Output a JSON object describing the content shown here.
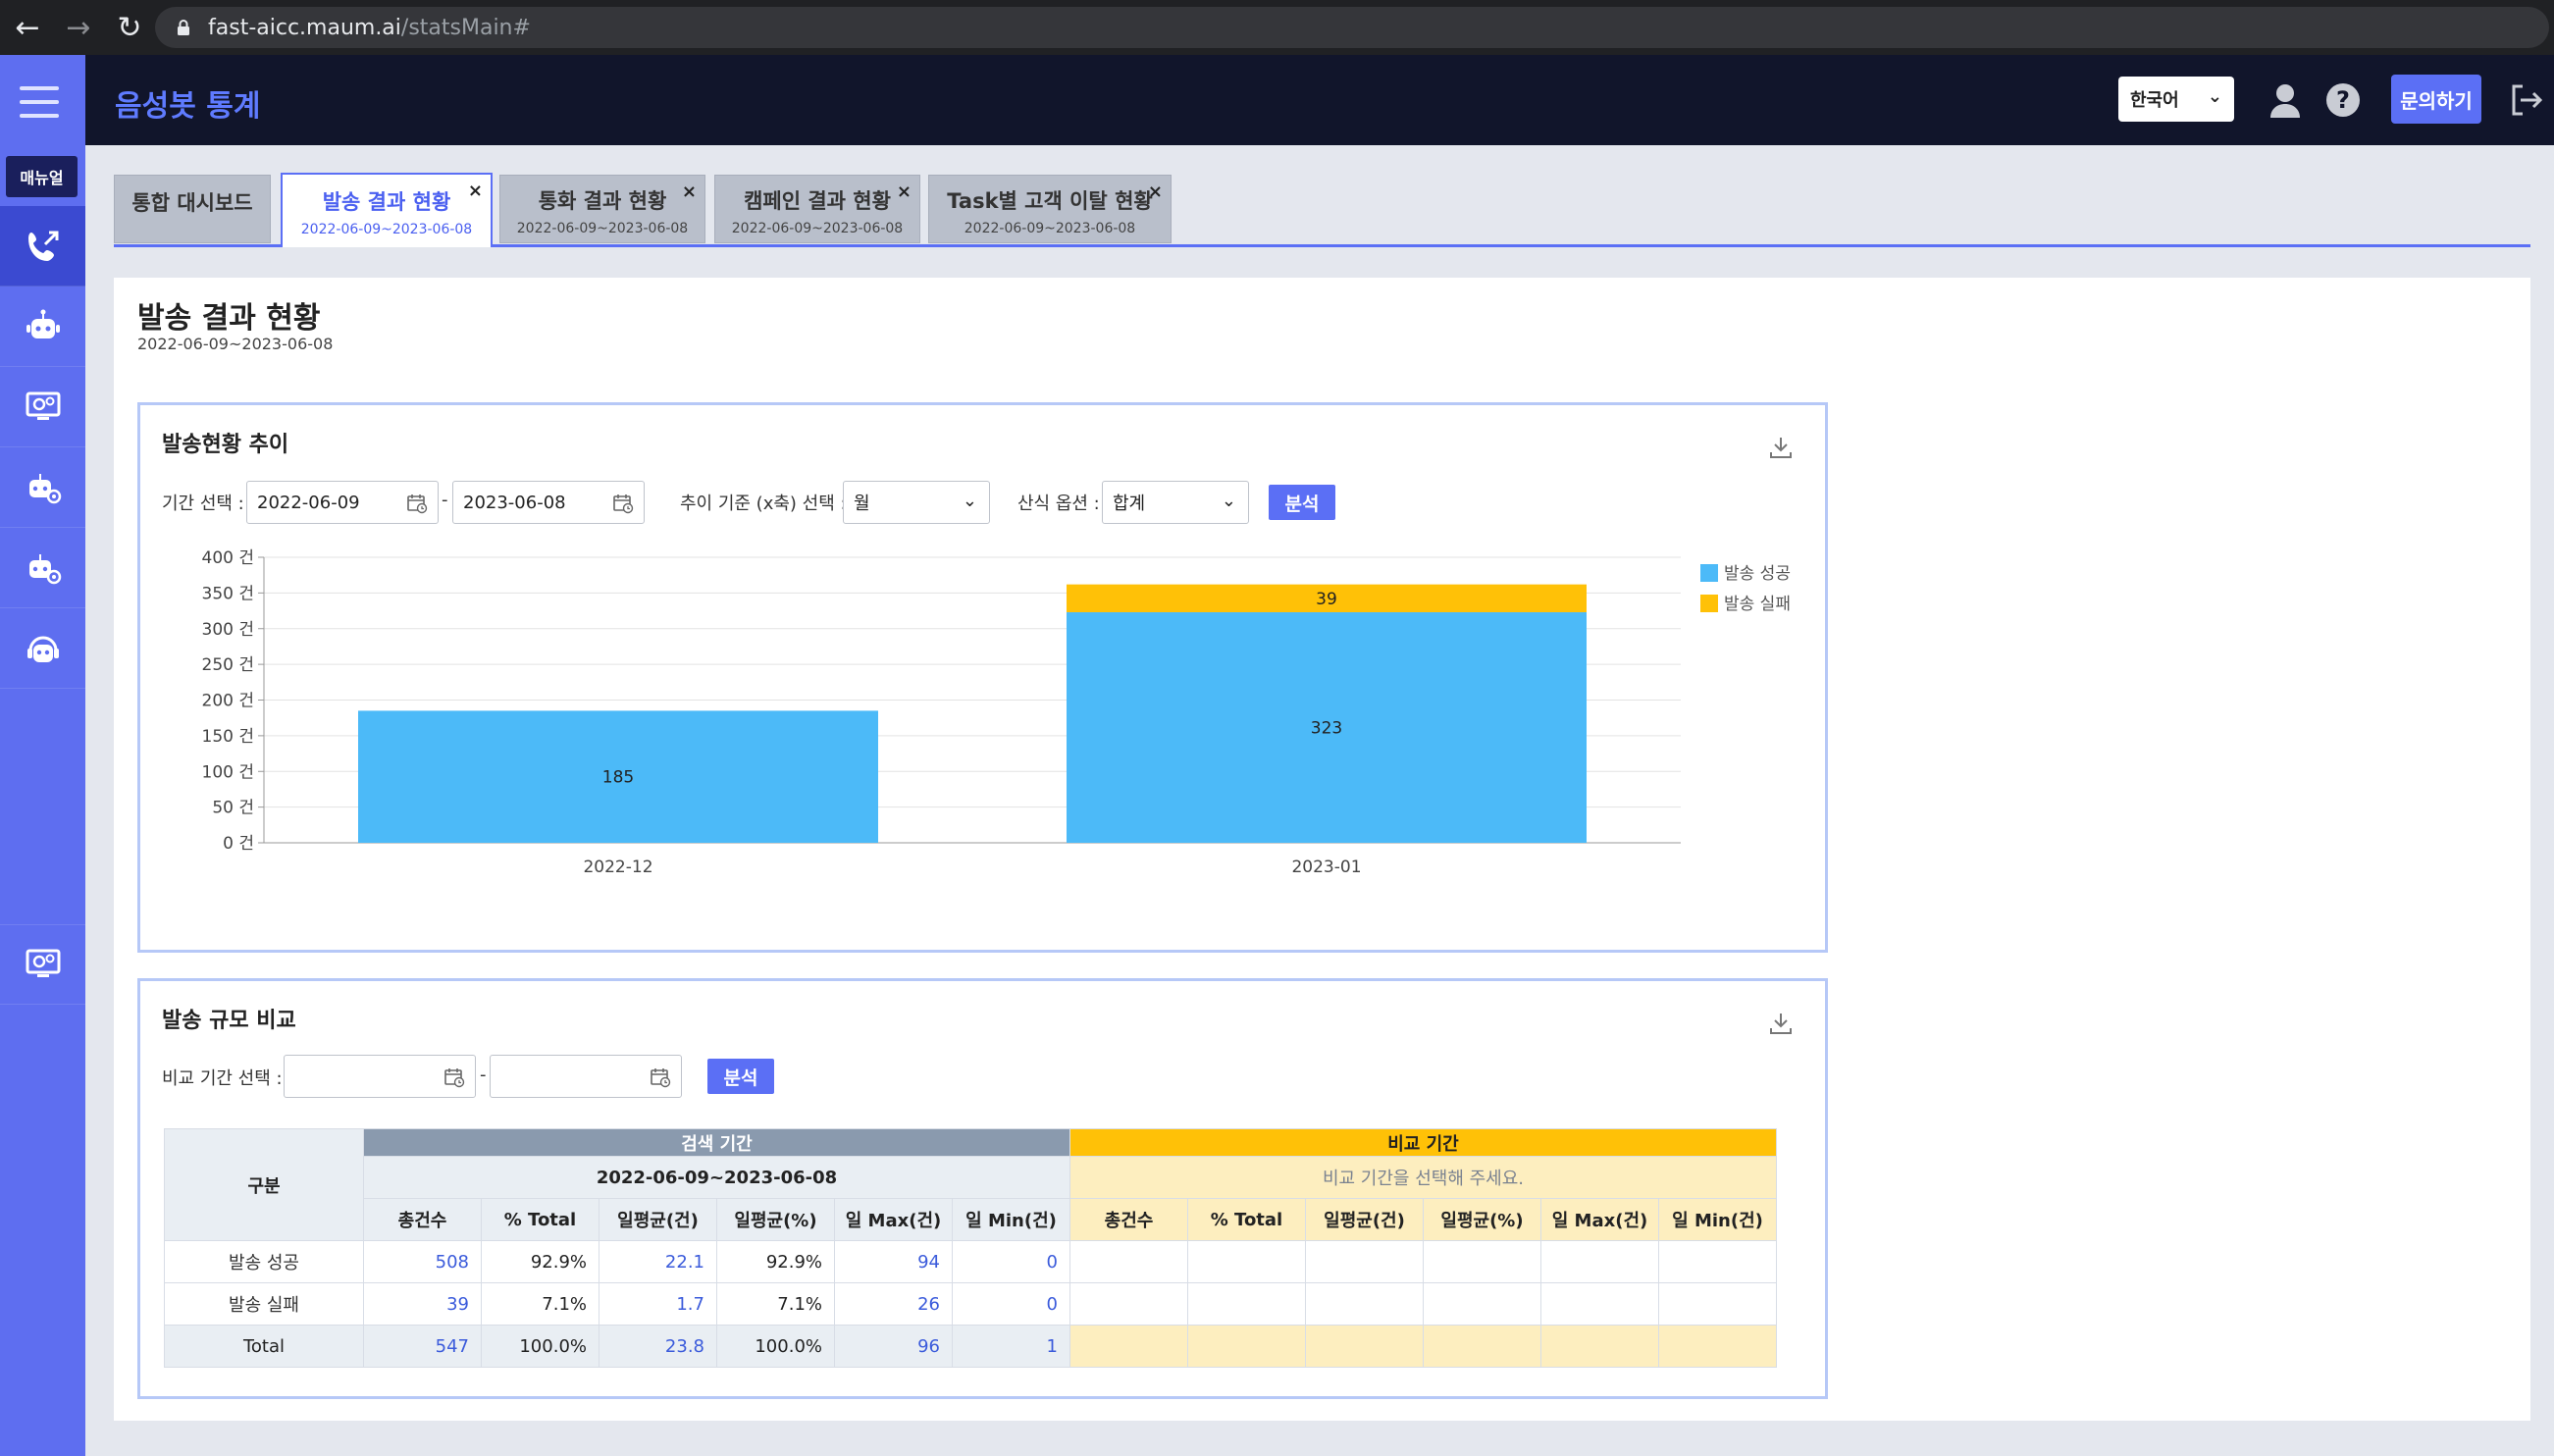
{
  "browser": {
    "url_host": "fast-aicc.maum.ai",
    "url_path": "/statsMain#"
  },
  "sidebar": {
    "manual_label": "매뉴얼",
    "items": [
      {
        "icon": "phone-transfer-icon",
        "active": true
      },
      {
        "icon": "robot-icon",
        "active": false
      },
      {
        "icon": "monitor-settings-icon",
        "active": false
      },
      {
        "icon": "robot-settings-icon",
        "active": false
      },
      {
        "icon": "robot-gear-icon",
        "active": false
      },
      {
        "icon": "headset-robot-icon",
        "active": false
      },
      {
        "icon": "monitor-gear-icon",
        "active": false
      }
    ]
  },
  "header": {
    "title": "음성봇 통계",
    "language": "한국어",
    "ask_label": "문의하기"
  },
  "tabs": [
    {
      "name": "통합 대시보드",
      "date": "",
      "closable": false,
      "active": false
    },
    {
      "name": "발송 결과 현황",
      "date": "2022-06-09~2023-06-08",
      "closable": true,
      "active": true
    },
    {
      "name": "통화 결과 현황",
      "date": "2022-06-09~2023-06-08",
      "closable": true,
      "active": false
    },
    {
      "name": "캠페인 결과 현황",
      "date": "2022-06-09~2023-06-08",
      "closable": true,
      "active": false
    },
    {
      "name": "Task별 고객 이탈 현황",
      "date": "2022-06-09~2023-06-08",
      "closable": true,
      "active": false
    }
  ],
  "page": {
    "title": "발송 결과 현황",
    "date_range": "2022-06-09~2023-06-08"
  },
  "trend_card": {
    "title": "발송현황 추이",
    "period_label": "기간 선택 :",
    "start_date": "2022-06-09",
    "end_date": "2023-06-08",
    "dash": "-",
    "axis_label": "추이 기준 (x축) 선택 :",
    "axis_value": "월",
    "calc_label": "산식 옵션 :",
    "calc_value": "합계",
    "analyze_label": "분석"
  },
  "chart_data": {
    "type": "bar",
    "stacked": true,
    "categories": [
      "2022-12",
      "2023-01"
    ],
    "series": [
      {
        "name": "발송 성공",
        "values": [
          185,
          323
        ],
        "color": "#4cbaf8"
      },
      {
        "name": "발송 실패",
        "values": [
          0,
          39
        ],
        "color": "#ffc107"
      }
    ],
    "ylim": [
      0,
      400
    ],
    "yticks": [
      0,
      50,
      100,
      150,
      200,
      250,
      300,
      350,
      400
    ],
    "ytick_suffix": " 건",
    "grid": true,
    "legend": "right"
  },
  "compare_card": {
    "title": "발송 규모 비교",
    "period_label": "비교 기간 선택 :",
    "start_date": "",
    "end_date": "",
    "dash": "-",
    "analyze_label": "분석",
    "table": {
      "gubun": "구분",
      "search_head": "검색 기간",
      "compare_head": "비교 기간",
      "search_range": "2022-06-09~2023-06-08",
      "compare_range": "비교 기간을 선택해 주세요.",
      "columns": [
        "총건수",
        "% Total",
        "일평균(건)",
        "일평균(%)",
        "일 Max(건)",
        "일 Min(건)"
      ],
      "rows": [
        {
          "label": "발송 성공",
          "values": [
            "508",
            "92.9%",
            "22.1",
            "92.9%",
            "94",
            "0"
          ]
        },
        {
          "label": "발송 실패",
          "values": [
            "39",
            "7.1%",
            "1.7",
            "7.1%",
            "26",
            "0"
          ]
        },
        {
          "label": "Total",
          "values": [
            "547",
            "100.0%",
            "23.8",
            "100.0%",
            "96",
            "1"
          ]
        }
      ]
    }
  }
}
